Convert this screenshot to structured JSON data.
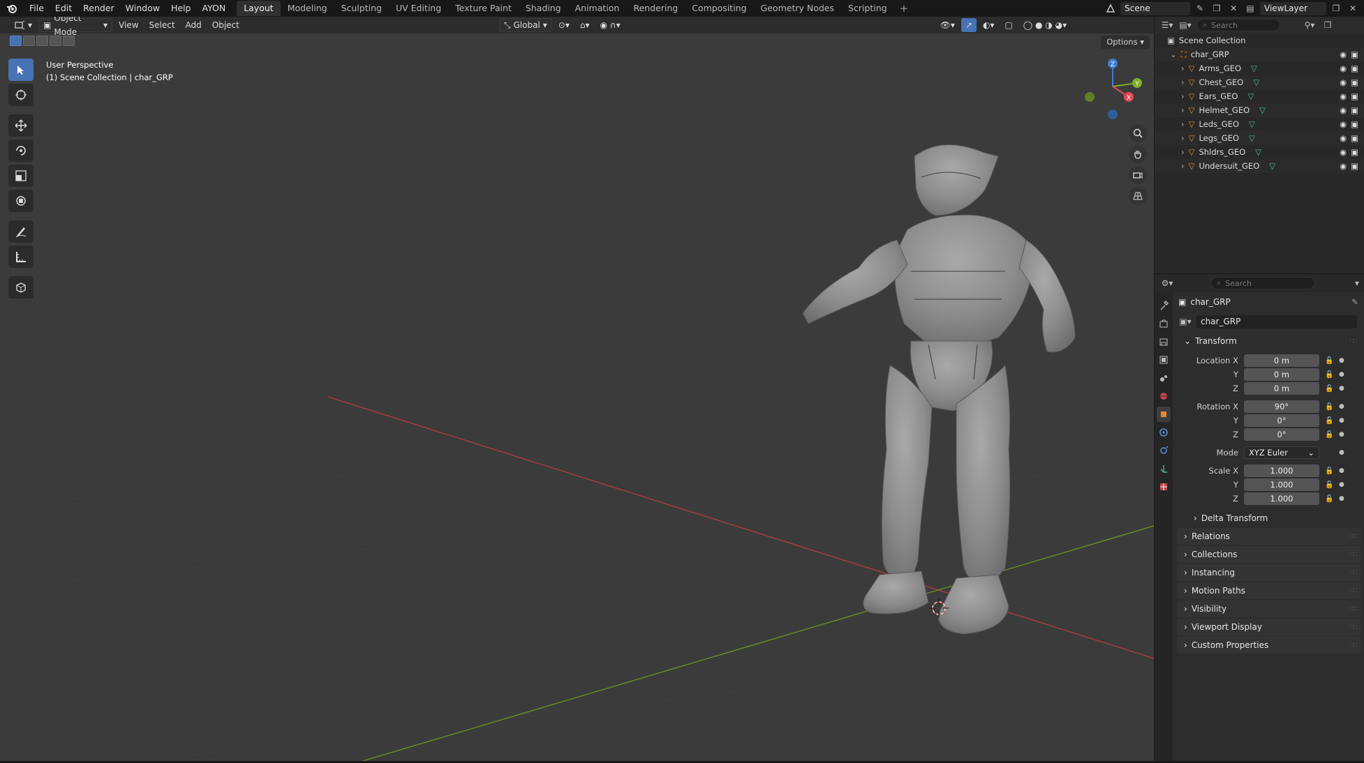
{
  "topbar": {
    "menus": [
      "File",
      "Edit",
      "Render",
      "Window",
      "Help",
      "AYON"
    ],
    "workspaces": [
      "Layout",
      "Modeling",
      "Sculpting",
      "UV Editing",
      "Texture Paint",
      "Shading",
      "Animation",
      "Rendering",
      "Compositing",
      "Geometry Nodes",
      "Scripting"
    ],
    "active_workspace": "Layout",
    "scene": "Scene",
    "view_layer": "ViewLayer"
  },
  "viewport": {
    "mode": "Object Mode",
    "menus": [
      "View",
      "Select",
      "Add",
      "Object"
    ],
    "orientation": "Global",
    "options_label": "Options",
    "info_line1": "User Perspective",
    "info_line2": "(1) Scene Collection | char_GRP",
    "gizmo_axes": [
      "Z",
      "Y",
      "X"
    ]
  },
  "outliner": {
    "search_placeholder": "Search",
    "root": "Scene Collection",
    "group": "char_GRP",
    "items": [
      "Arms_GEO",
      "Chest_GEO",
      "Ears_GEO",
      "Helmet_GEO",
      "Leds_GEO",
      "Legs_GEO",
      "Shldrs_GEO",
      "Undersuit_GEO"
    ]
  },
  "properties": {
    "search_placeholder": "Search",
    "object_name": "char_GRP",
    "object_field": "char_GRP",
    "transform": {
      "title": "Transform",
      "location_label": "Location X",
      "location": [
        "0 m",
        "0 m",
        "0 m"
      ],
      "rotation_label": "Rotation X",
      "rotation": [
        "90°",
        "0°",
        "0°"
      ],
      "mode_label": "Mode",
      "mode": "XYZ Euler",
      "scale_label": "Scale X",
      "scale": [
        "1.000",
        "1.000",
        "1.000"
      ],
      "y_label": "Y",
      "z_label": "Z",
      "delta": "Delta Transform"
    },
    "panels": [
      "Relations",
      "Collections",
      "Instancing",
      "Motion Paths",
      "Visibility",
      "Viewport Display",
      "Custom Properties"
    ]
  },
  "colors": {
    "accent": "#4772b3",
    "object_orange": "#e8862a",
    "mesh_green": "#4fb9a0",
    "x_axis": "#e04b55",
    "y_axis": "#7fb02a",
    "z_axis": "#3d7fd3"
  }
}
